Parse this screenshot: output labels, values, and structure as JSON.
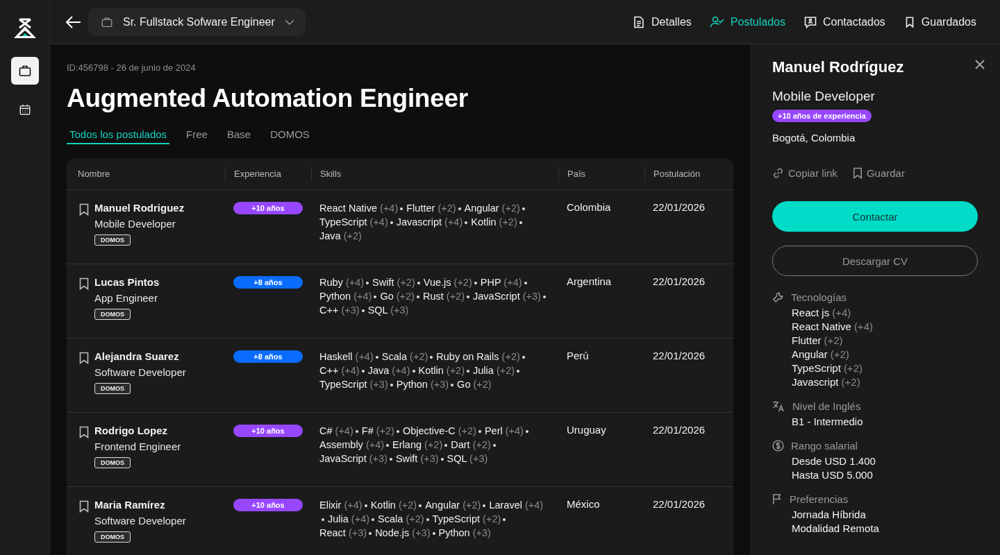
{
  "top_bar": {
    "job_selector": "Sr. Fullstack Sofware Engineer",
    "nav": [
      {
        "label": "Detalles",
        "kind": "details",
        "selected": false
      },
      {
        "label": "Postulados",
        "kind": "applicants",
        "selected": true
      },
      {
        "label": "Contactados",
        "kind": "contacted",
        "selected": false
      },
      {
        "label": "Guardados",
        "kind": "saved",
        "selected": false
      }
    ]
  },
  "sidebar": {
    "items": [
      {
        "kind": "jobs",
        "selected": true
      },
      {
        "kind": "calendar",
        "selected": false
      }
    ]
  },
  "job": {
    "meta": "ID:456798 - 26 de junio de 2024",
    "title": "Augmented Automation Engineer"
  },
  "filter_tabs": [
    {
      "label": "Todos los postulados",
      "selected": true
    },
    {
      "label": "Free",
      "selected": false
    },
    {
      "label": "Base",
      "selected": false
    },
    {
      "label": "DOMOS",
      "selected": false
    }
  ],
  "table": {
    "columns": [
      "Nombre",
      "Experiencia",
      "Skills",
      "País",
      "Postulación"
    ],
    "rows": [
      {
        "name": "Manuel Rodriguez",
        "role": "Mobile Developer",
        "tag": "DOMOS",
        "experience": {
          "label": "+10 años",
          "color": "#9747ff"
        },
        "skills": [
          {
            "name": "React Native",
            "extra": "(+4)"
          },
          {
            "name": "Flutter",
            "extra": "(+2)"
          },
          {
            "name": "Angular",
            "extra": "(+2)"
          },
          {
            "name": "TypeScript",
            "extra": "(+4)"
          },
          {
            "name": "Javascript",
            "extra": "(+4)"
          },
          {
            "name": "Kotlin",
            "extra": "(+2)"
          },
          {
            "name": "Java",
            "extra": "(+2)"
          }
        ],
        "country": "Colombia",
        "date": "22/01/2026"
      },
      {
        "name": "Lucas Pintos",
        "role": "App Engineer",
        "tag": "DOMOS",
        "experience": {
          "label": "+8 años",
          "color": "#0a6cff"
        },
        "skills": [
          {
            "name": "Ruby",
            "extra": "(+4)"
          },
          {
            "name": "Swift",
            "extra": "(+2)"
          },
          {
            "name": "Vue.js",
            "extra": "(+2)"
          },
          {
            "name": "PHP",
            "extra": "(+4)"
          },
          {
            "name": "Python",
            "extra": "(+4)"
          },
          {
            "name": "Go",
            "extra": "(+2)"
          },
          {
            "name": "Rust",
            "extra": "(+2)"
          },
          {
            "name": "JavaScript",
            "extra": "(+3)"
          },
          {
            "name": "C++",
            "extra": "(+3)"
          },
          {
            "name": "SQL",
            "extra": "(+3)"
          }
        ],
        "country": "Argentina",
        "date": "22/01/2026"
      },
      {
        "name": "Alejandra Suarez",
        "role": "Software Developer",
        "tag": "DOMOS",
        "experience": {
          "label": "+8 años",
          "color": "#0a6cff"
        },
        "skills": [
          {
            "name": "Haskell",
            "extra": "(+4)"
          },
          {
            "name": "Scala",
            "extra": "(+2)"
          },
          {
            "name": "Ruby on Rails",
            "extra": "(+2)"
          },
          {
            "name": "C++",
            "extra": "(+4)"
          },
          {
            "name": "Java",
            "extra": "(+4)"
          },
          {
            "name": "Kotlin",
            "extra": "(+2)"
          },
          {
            "name": "Julia",
            "extra": "(+2)"
          },
          {
            "name": "TypeScript",
            "extra": "(+3)"
          },
          {
            "name": "Python",
            "extra": "(+3)"
          },
          {
            "name": "Go",
            "extra": "(+2)"
          }
        ],
        "country": "Perú",
        "date": "22/01/2026"
      },
      {
        "name": "Rodrigo Lopez",
        "role": "Frontend Engineer",
        "tag": "DOMOS",
        "experience": {
          "label": "+10 años",
          "color": "#9747ff"
        },
        "skills": [
          {
            "name": "C#",
            "extra": "(+4)"
          },
          {
            "name": "F#",
            "extra": "(+2)"
          },
          {
            "name": "Objective-C",
            "extra": "(+2)"
          },
          {
            "name": "Perl",
            "extra": "(+4)"
          },
          {
            "name": "Assembly",
            "extra": "(+4)"
          },
          {
            "name": "Erlang",
            "extra": "(+2)"
          },
          {
            "name": "Dart",
            "extra": "(+2)"
          },
          {
            "name": "JavaScript",
            "extra": "(+3)"
          },
          {
            "name": "Swift",
            "extra": "(+3)"
          },
          {
            "name": "SQL",
            "extra": "(+3)"
          }
        ],
        "country": "Uruguay",
        "date": "22/01/2026"
      },
      {
        "name": "Maria Ramírez",
        "role": "Software Developer",
        "tag": "DOMOS",
        "experience": {
          "label": "+10 años",
          "color": "#9747ff"
        },
        "skills": [
          {
            "name": "Elixir",
            "extra": "(+4)"
          },
          {
            "name": "Kotlin",
            "extra": "(+2)"
          },
          {
            "name": "Angular",
            "extra": "(+2)"
          },
          {
            "name": "Laravel",
            "extra": "(+4)"
          },
          {
            "name": "Julia",
            "extra": "(+4)"
          },
          {
            "name": "Scala",
            "extra": "(+2)"
          },
          {
            "name": "TypeScript",
            "extra": "(+2)"
          },
          {
            "name": "React",
            "extra": "(+3)"
          },
          {
            "name": "Node.js",
            "extra": "(+3)"
          },
          {
            "name": "Python",
            "extra": "(+3)"
          }
        ],
        "country": "México",
        "date": "22/01/2026"
      }
    ]
  },
  "detail_panel": {
    "name": "Manuel Rodríguez",
    "role": "Mobile Developer",
    "experience": {
      "label": "+10 años de experiencia",
      "color": "#9747ff"
    },
    "location": "Bogotá, Colombia",
    "actions": [
      "Copiar link",
      "Guardar"
    ],
    "primary_button": "Contactar",
    "secondary_button": "Descargar CV",
    "sections": [
      {
        "kind": "tech",
        "title": "Tecnologías",
        "items": [
          {
            "name": "React js",
            "extra": "(+4)"
          },
          {
            "name": "React Native",
            "extra": "(+4)"
          },
          {
            "name": "Flutter",
            "extra": "(+2)"
          },
          {
            "name": "Angular",
            "extra": "(+2)"
          },
          {
            "name": "TypeScript",
            "extra": "(+2)"
          },
          {
            "name": "Javascript",
            "extra": "(+2)"
          }
        ]
      },
      {
        "kind": "language",
        "title": "Nivel de Inglés",
        "items": [
          {
            "name": "B1 - Intermedio"
          }
        ]
      },
      {
        "kind": "salary",
        "title": "Rango salarial",
        "items": [
          {
            "name": "Desde USD 1.400"
          },
          {
            "name": "Hasta USD 5.000"
          }
        ]
      },
      {
        "kind": "preferences",
        "title": "Preferencias",
        "items": [
          {
            "name": "Jornada Híbrida"
          },
          {
            "name": "Modalidad Remota"
          }
        ]
      }
    ]
  }
}
